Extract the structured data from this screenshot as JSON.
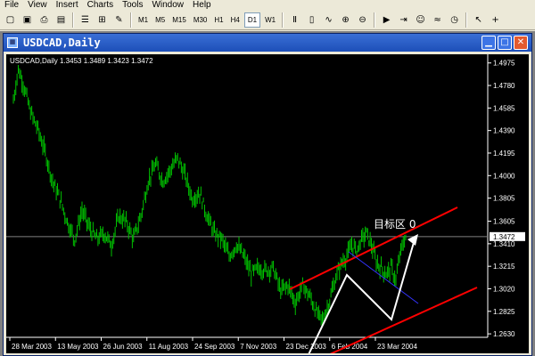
{
  "menubar": {
    "items": [
      "File",
      "View",
      "Insert",
      "Charts",
      "Tools",
      "Window",
      "Help"
    ]
  },
  "toolbar": {
    "buttons": [
      "new-chart-icon",
      "save-icon",
      "print-icon",
      "properties-icon",
      "navigator-icon",
      "data-window-icon",
      "expert-icon"
    ],
    "timeframes": [
      "M1",
      "M5",
      "M15",
      "M30",
      "H1",
      "H4",
      "D1",
      "W1"
    ],
    "active_timeframe": "D1",
    "right_buttons": [
      "bar-chart-icon",
      "candlestick-icon",
      "line-chart-icon",
      "zoom-in-icon",
      "zoom-out-icon",
      "autoscroll-icon",
      "chart-shift-icon",
      "expert-advisors-icon",
      "indicator-icon",
      "period-icon",
      "cursor-icon",
      "crosshair-icon"
    ]
  },
  "window": {
    "title": "USDCAD,Daily"
  },
  "chart": {
    "header": "USDCAD,Daily  1.3453 1.3489 1.3423 1.3472",
    "current_price_label": "1.3472",
    "annotation": "目标区 0",
    "colors": {
      "background": "#000000",
      "bars": "#00c000",
      "channel": "#ff0000",
      "pattern": "#ffffff",
      "trendline": "#3333ff",
      "price_line": "#808080"
    }
  },
  "chart_data": {
    "type": "bar",
    "symbol": "USDCAD",
    "timeframe": "Daily",
    "ohlc_last": {
      "open": 1.3453,
      "high": 1.3489,
      "low": 1.3423,
      "close": 1.3472
    },
    "y_ticks": [
      "1.4975",
      "1.4780",
      "1.4585",
      "1.4390",
      "1.4195",
      "1.4000",
      "1.3805",
      "1.3605",
      "1.3410",
      "1.3215",
      "1.3020",
      "1.2825",
      "1.2630"
    ],
    "x_ticks": [
      "28 Mar 2003",
      "13 May 2003",
      "26 Jun 2003",
      "11 Aug 2003",
      "24 Sep 2003",
      "7 Nov 2003",
      "23 Dec 2003",
      "6 Feb 2004",
      "23 Mar 2004"
    ],
    "ylim": [
      1.26,
      1.505
    ],
    "current_price": 1.3472,
    "price_path": [
      [
        0,
        1.465
      ],
      [
        4,
        1.492
      ],
      [
        8,
        1.48
      ],
      [
        14,
        1.455
      ],
      [
        20,
        1.44
      ],
      [
        26,
        1.42
      ],
      [
        32,
        1.395
      ],
      [
        38,
        1.38
      ],
      [
        44,
        1.36
      ],
      [
        50,
        1.345
      ],
      [
        56,
        1.37
      ],
      [
        62,
        1.355
      ],
      [
        68,
        1.345
      ],
      [
        74,
        1.35
      ],
      [
        80,
        1.34
      ],
      [
        86,
        1.365
      ],
      [
        92,
        1.36
      ],
      [
        98,
        1.345
      ],
      [
        104,
        1.365
      ],
      [
        110,
        1.395
      ],
      [
        116,
        1.41
      ],
      [
        122,
        1.395
      ],
      [
        128,
        1.405
      ],
      [
        134,
        1.415
      ],
      [
        140,
        1.4
      ],
      [
        146,
        1.38
      ],
      [
        152,
        1.385
      ],
      [
        158,
        1.365
      ],
      [
        164,
        1.35
      ],
      [
        170,
        1.345
      ],
      [
        176,
        1.33
      ],
      [
        182,
        1.34
      ],
      [
        188,
        1.33
      ],
      [
        194,
        1.315
      ],
      [
        200,
        1.32
      ],
      [
        206,
        1.318
      ],
      [
        212,
        1.32
      ],
      [
        218,
        1.3
      ],
      [
        224,
        1.305
      ],
      [
        230,
        1.29
      ],
      [
        236,
        1.305
      ],
      [
        242,
        1.295
      ],
      [
        248,
        1.28
      ],
      [
        252,
        1.275
      ],
      [
        256,
        1.285
      ],
      [
        260,
        1.3
      ],
      [
        264,
        1.315
      ],
      [
        268,
        1.325
      ],
      [
        272,
        1.33
      ],
      [
        276,
        1.34
      ],
      [
        280,
        1.335
      ],
      [
        284,
        1.345
      ],
      [
        288,
        1.35
      ],
      [
        292,
        1.34
      ],
      [
        296,
        1.325
      ],
      [
        300,
        1.32
      ],
      [
        304,
        1.315
      ],
      [
        308,
        1.32
      ],
      [
        312,
        1.31
      ],
      [
        316,
        1.335
      ],
      [
        320,
        1.347
      ]
    ]
  }
}
